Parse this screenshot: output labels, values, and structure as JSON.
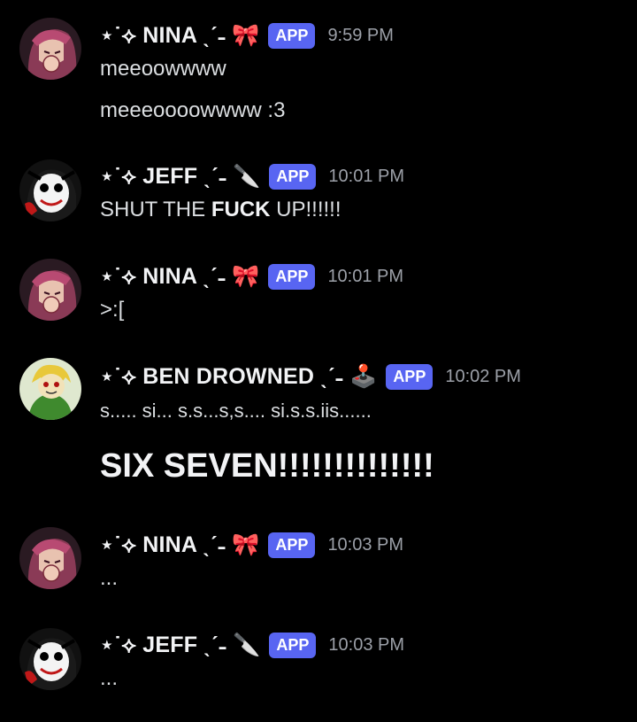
{
  "messages": [
    {
      "author": "⋆˙⟡ NINA ˎˊ˗ 🎀",
      "badge": "APP",
      "time": "9:59 PM",
      "lines": [
        "meeoowwww",
        "meeeoooowwww :3"
      ]
    },
    {
      "author": "⋆˙⟡ JEFF ˎˊ˗ 🔪",
      "badge": "APP",
      "time": "10:01 PM",
      "line_pre": "SHUT THE ",
      "line_bold": "FUCK",
      "line_post": " UP!!!!!!"
    },
    {
      "author": "⋆˙⟡ NINA ˎˊ˗ 🎀",
      "badge": "APP",
      "time": "10:01 PM",
      "lines": [
        ">:["
      ]
    },
    {
      "author": "⋆˙⟡ BEN DROWNED ˎˊ˗ 🕹️",
      "badge": "APP",
      "time": "10:02 PM",
      "lines": [
        "s..... si... s.s...s,s.... si.s.s.iis......"
      ],
      "big_line": "SIX SEVEN!!!!!!!!!!!!!!"
    },
    {
      "author": "⋆˙⟡ NINA ˎˊ˗ 🎀",
      "badge": "APP",
      "time": "10:03 PM",
      "lines": [
        "..."
      ]
    },
    {
      "author": "⋆˙⟡ JEFF ˎˊ˗ 🔪",
      "badge": "APP",
      "time": "10:03 PM",
      "lines": [
        "..."
      ]
    }
  ],
  "colors": {
    "background": "#000000",
    "badge": "#5865f2",
    "username": "#f2f3f5",
    "text": "#dbdee1",
    "timestamp": "#9ca0a8"
  }
}
